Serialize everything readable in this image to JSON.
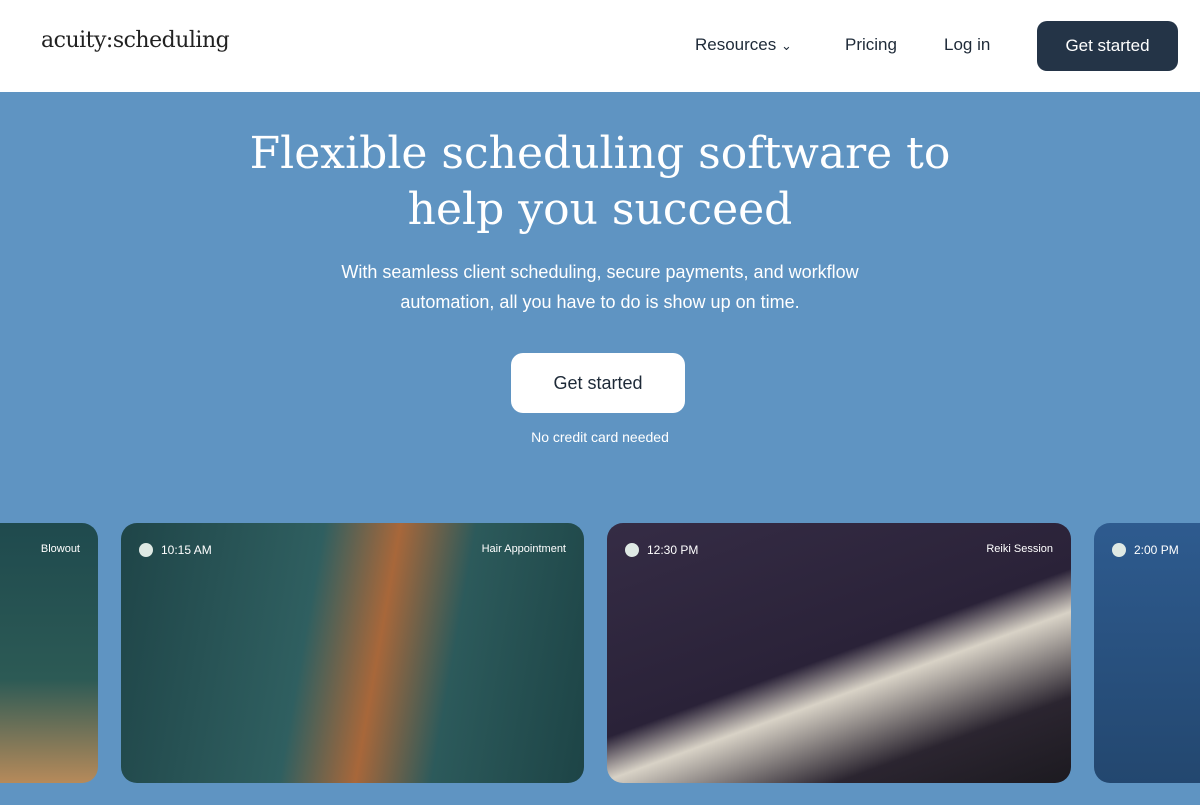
{
  "nav": {
    "logo": "acuity:scheduling",
    "resources": "Resources",
    "pricing": "Pricing",
    "login": "Log in",
    "cta": "Get started"
  },
  "hero": {
    "title_line1": "Flexible scheduling software to",
    "title_line2": "help you succeed",
    "subtitle_line1": "With seamless client scheduling, secure payments, and workflow",
    "subtitle_line2": "automation, all you have to do is show up on time.",
    "cta": "Get started",
    "note": "No credit card needed"
  },
  "cards": [
    {
      "time": "",
      "label": "Blowout"
    },
    {
      "time": "10:15 AM",
      "label": "Hair Appointment"
    },
    {
      "time": "12:30 PM",
      "label": "Reiki Session"
    },
    {
      "time": "2:00 PM",
      "label": ""
    }
  ]
}
